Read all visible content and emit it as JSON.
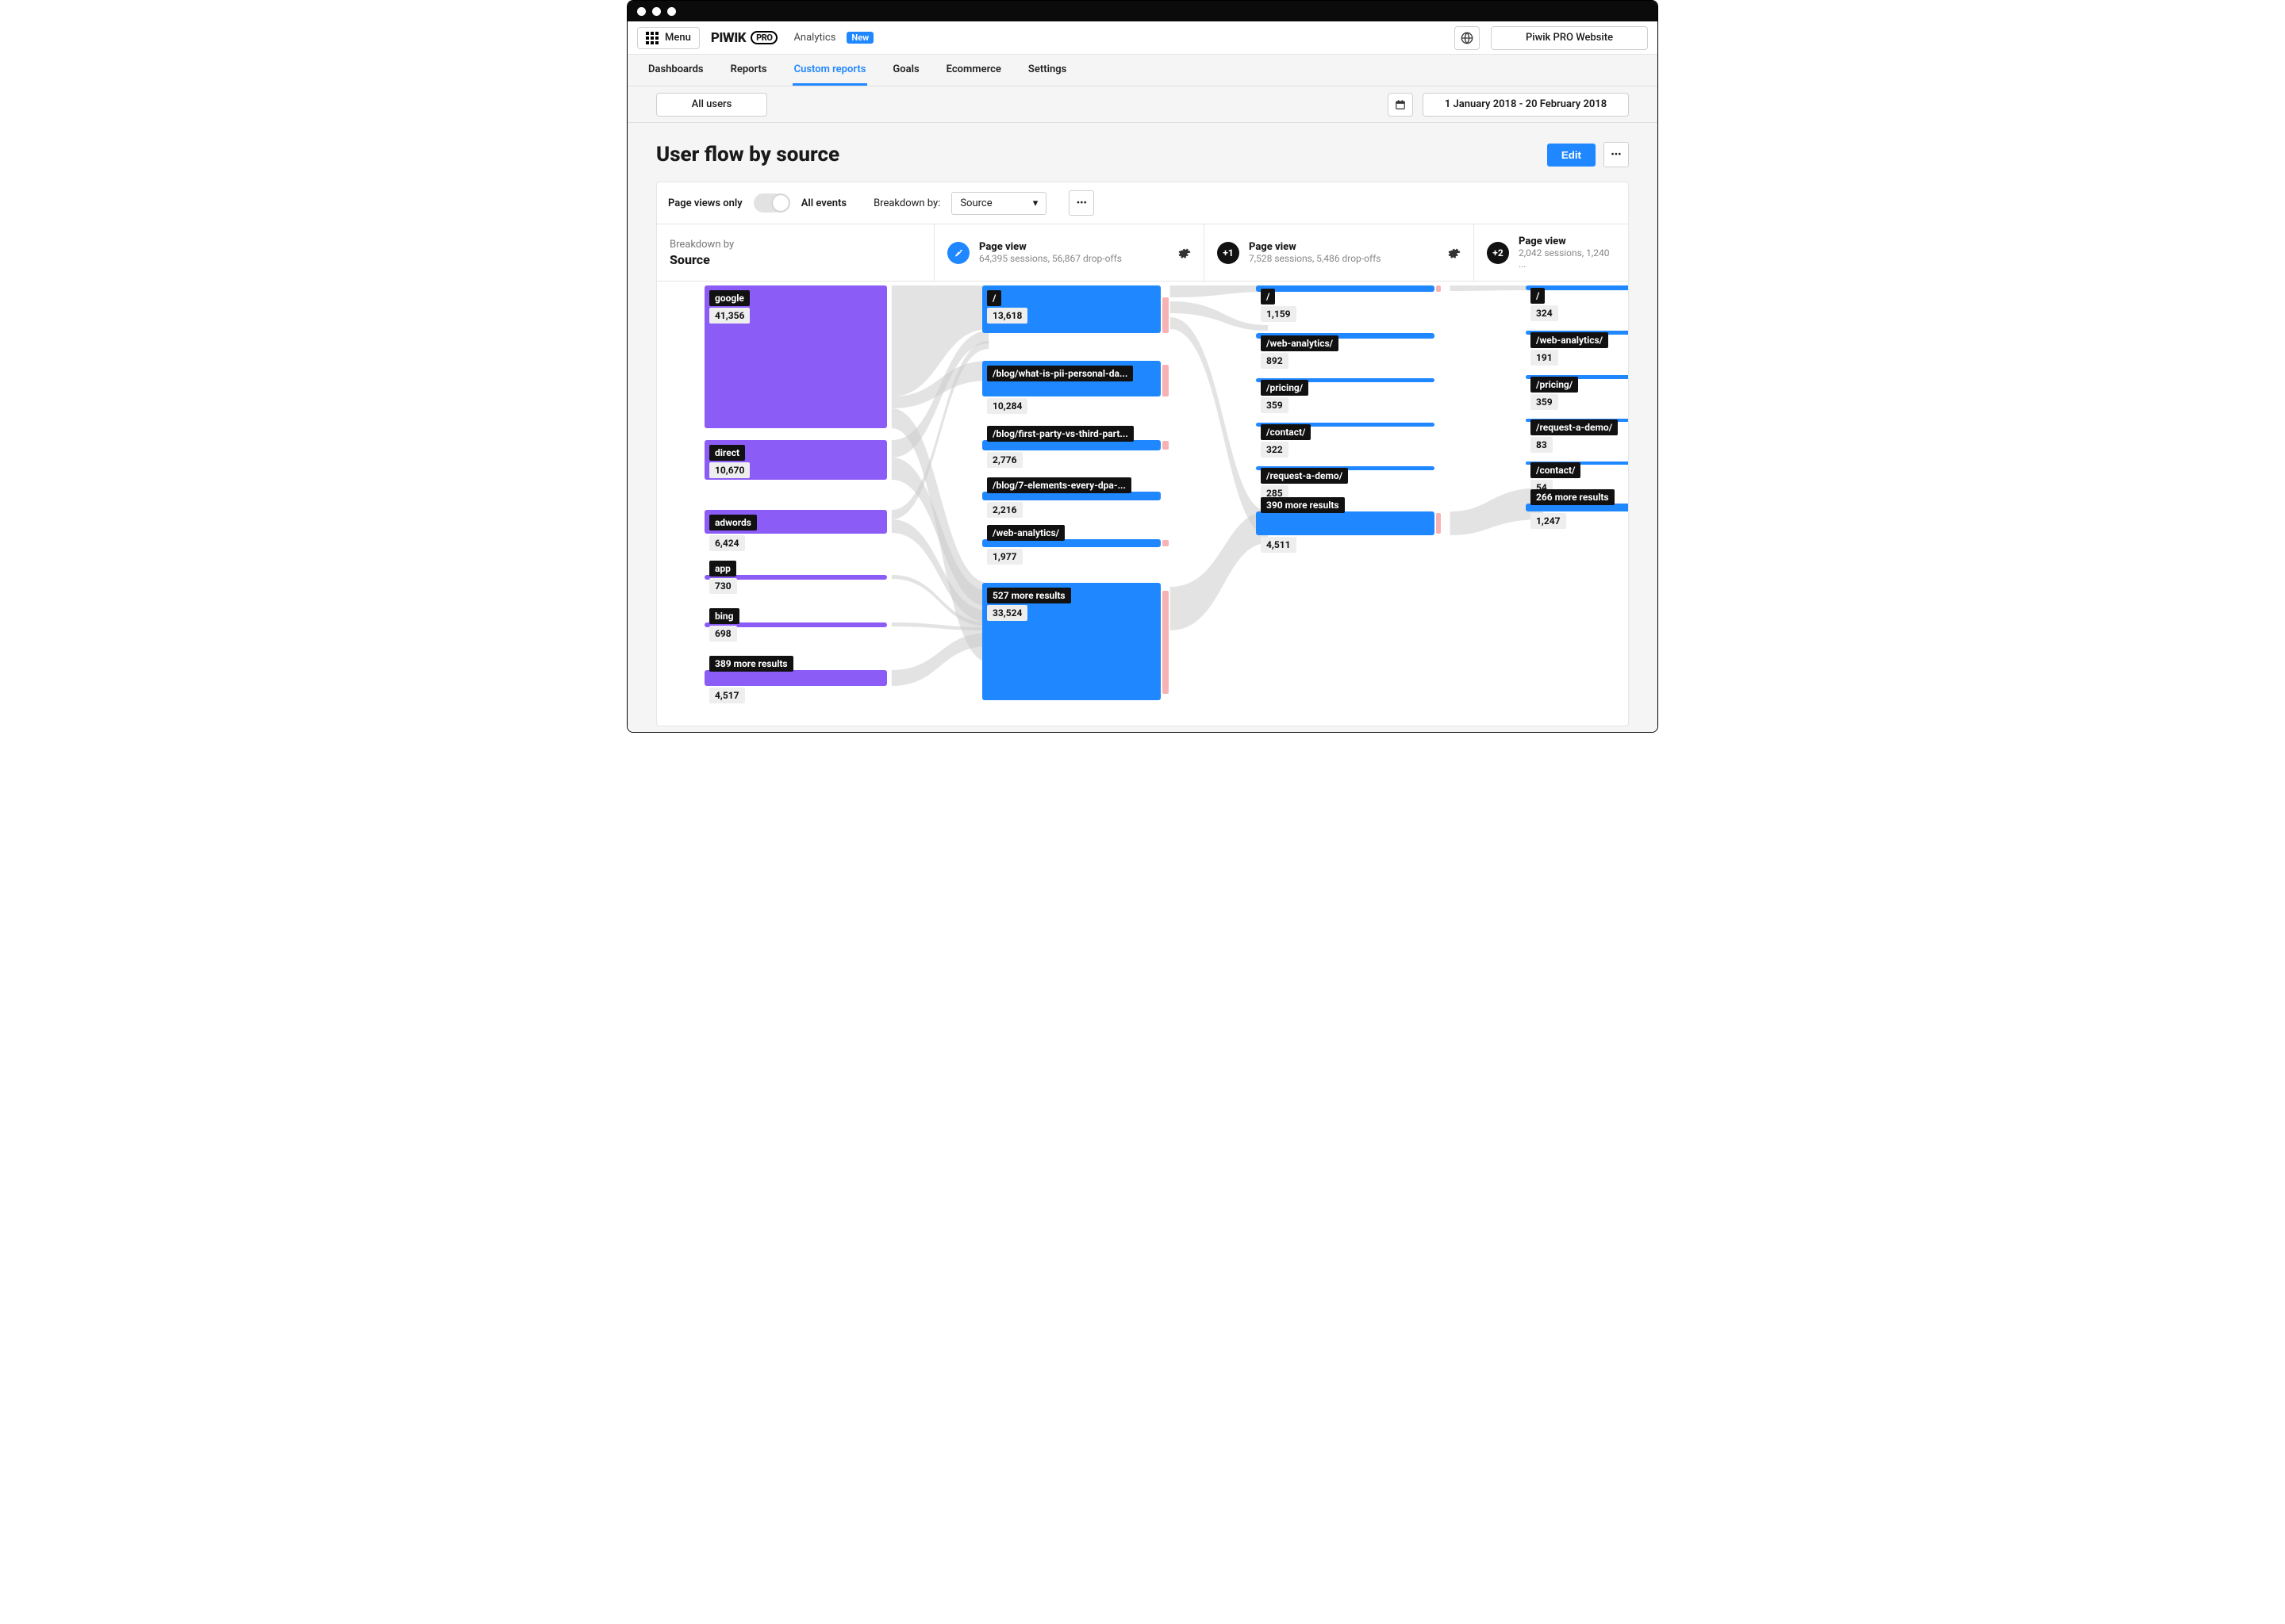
{
  "topbar": {
    "menu_label": "Menu",
    "brand": "PIWIK",
    "brand_suffix": "PRO",
    "section": "Analytics",
    "new_badge": "New",
    "site_name": "Piwik PRO Website"
  },
  "tabs": [
    "Dashboards",
    "Reports",
    "Custom reports",
    "Goals",
    "Ecommerce",
    "Settings"
  ],
  "active_tab": "Custom reports",
  "filters": {
    "segment_label": "All users",
    "date_range": "1 January 2018 - 20 February 2018"
  },
  "report": {
    "title": "User flow by source",
    "edit_label": "Edit"
  },
  "controls": {
    "toggle_left": "Page views only",
    "toggle_right": "All events",
    "breakdown_label": "Breakdown by:",
    "breakdown_value": "Source"
  },
  "column_headers": [
    {
      "subtitle": "Breakdown by",
      "title": "Source"
    },
    {
      "icon_text": "",
      "title": "Page view",
      "subtitle": "64,395 sessions, 56,867 drop-offs"
    },
    {
      "icon_text": "+1",
      "title": "Page view",
      "subtitle": "7,528 sessions, 5,486 drop-offs"
    },
    {
      "icon_text": "+2",
      "title": "Page view",
      "subtitle": "2,042 sessions, 1,240 ..."
    }
  ],
  "chart_data": {
    "type": "sankey",
    "columns": [
      {
        "dimension": "Source",
        "nodes": [
          {
            "label": "google",
            "value": "41,356"
          },
          {
            "label": "direct",
            "value": "10,670"
          },
          {
            "label": "adwords",
            "value": "6,424"
          },
          {
            "label": "app",
            "value": "730"
          },
          {
            "label": "bing",
            "value": "698"
          },
          {
            "label": "389 more results",
            "value": "4,517"
          }
        ]
      },
      {
        "dimension": "Page view",
        "sessions": 64395,
        "drop_offs": 56867,
        "nodes": [
          {
            "label": "/",
            "value": "13,618"
          },
          {
            "label": "/blog/what-is-pii-personal-da...",
            "value": "10,284"
          },
          {
            "label": "/blog/first-party-vs-third-part...",
            "value": "2,776"
          },
          {
            "label": "/blog/7-elements-every-dpa-...",
            "value": "2,216"
          },
          {
            "label": "/web-analytics/",
            "value": "1,977"
          },
          {
            "label": "527 more results",
            "value": "33,524"
          }
        ]
      },
      {
        "dimension": "Page view",
        "sessions": 7528,
        "drop_offs": 5486,
        "nodes": [
          {
            "label": "/",
            "value": "1,159"
          },
          {
            "label": "/web-analytics/",
            "value": "892"
          },
          {
            "label": "/pricing/",
            "value": "359"
          },
          {
            "label": "/contact/",
            "value": "322"
          },
          {
            "label": "/request-a-demo/",
            "value": "285"
          },
          {
            "label": "390 more results",
            "value": "4,511"
          }
        ]
      },
      {
        "dimension": "Page view",
        "sessions": 2042,
        "drop_offs": 1240,
        "nodes": [
          {
            "label": "/",
            "value": "324"
          },
          {
            "label": "/web-analytics/",
            "value": "191"
          },
          {
            "label": "/pricing/",
            "value": "359"
          },
          {
            "label": "/request-a-demo/",
            "value": "83"
          },
          {
            "label": "/contact/",
            "value": "54"
          },
          {
            "label": "266 more results",
            "value": "1,247"
          }
        ]
      }
    ]
  }
}
